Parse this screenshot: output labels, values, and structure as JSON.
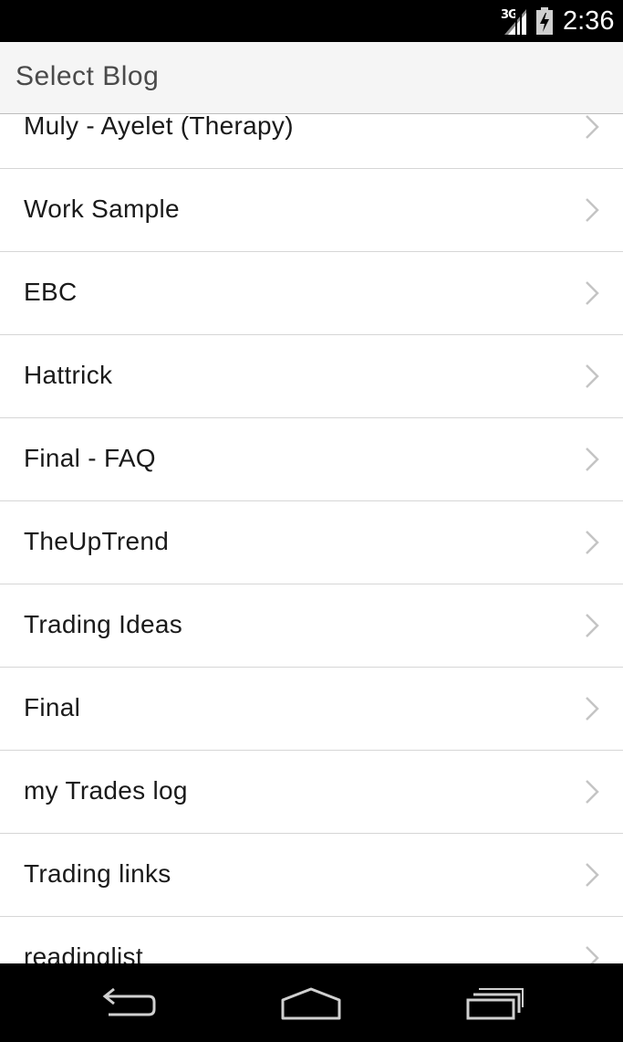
{
  "status_bar": {
    "network_type": "3G",
    "time": "2:36",
    "icons": [
      "signal-icon",
      "battery-icon"
    ]
  },
  "action_bar": {
    "title": "Select Blog"
  },
  "blogs": [
    {
      "label": "Muly - Ayelet (Therapy)"
    },
    {
      "label": "Work Sample"
    },
    {
      "label": "EBC"
    },
    {
      "label": "Hattrick"
    },
    {
      "label": "Final - FAQ"
    },
    {
      "label": "TheUpTrend"
    },
    {
      "label": "Trading Ideas"
    },
    {
      "label": "Final"
    },
    {
      "label": "my Trades log"
    },
    {
      "label": "Trading links"
    },
    {
      "label": "readinglist"
    }
  ],
  "nav_bar": {
    "icons": [
      "back-icon",
      "home-icon",
      "recents-icon"
    ]
  },
  "colors": {
    "status_bar": "#000000",
    "action_bar": "#f5f5f5",
    "divider": "#d6d6d6",
    "chevron": "#c4c4c4",
    "text": "#1a1a1a"
  }
}
